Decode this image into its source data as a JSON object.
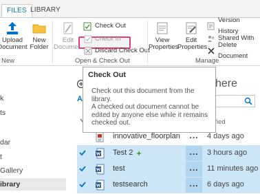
{
  "tabs": [
    "FILES",
    "LIBRARY"
  ],
  "ribbon": {
    "upload": "Upload\nDocument",
    "new_folder": "New\nFolder",
    "edit_document": "Edit\nDocument",
    "check_out": "Check Out",
    "check_in": "Check In",
    "discard_check_out": "Discard Check Out",
    "view_properties": "View\nProperties",
    "edit_properties": "Edit\nProperties",
    "version_history": "Version History",
    "shared_with": "Shared With",
    "delete_document": "Delete Document",
    "groups": {
      "new": "New",
      "open_check_out": "Open & Check Out",
      "manage": "Manage"
    }
  },
  "tooltip": {
    "title": "Check Out",
    "body": "Check out this document from the library.\nA checked out document cannot be edited by anyone else while it remains checked out."
  },
  "nav": {
    "items": [
      "k",
      "ts",
      "dar",
      "t",
      "Gallery",
      "ibrary"
    ]
  },
  "content": {
    "here_fragment": "here",
    "all_fragment": "Al",
    "modified_fragment": "dified",
    "more_glyph": "...",
    "rows": [
      {
        "name": "innovative_floorplan",
        "modified": "4 days ago",
        "selected": false,
        "new": false
      },
      {
        "name": "Test 2",
        "modified": "3 hours ago",
        "selected": true,
        "new": true
      },
      {
        "name": "test",
        "modified": "11 minutes ago",
        "selected": true,
        "new": false
      },
      {
        "name": "testsearch",
        "modified": "6 days ago",
        "selected": true,
        "new": false
      }
    ]
  },
  "colors": {
    "accent": "#0072c6",
    "highlight": "#e23c7a",
    "selected_row": "#cde6f7"
  }
}
